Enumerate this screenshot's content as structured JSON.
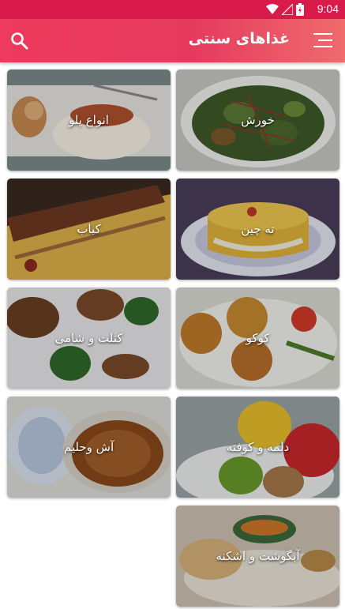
{
  "status_bar": {
    "time": "9:04",
    "icons": [
      "wifi-icon",
      "signal-icon",
      "battery-icon"
    ]
  },
  "app_bar": {
    "title": "غذاهای سنتی",
    "menu_icon": "menu-icon",
    "search_icon": "search-icon",
    "color": "#e8395d"
  },
  "categories": [
    {
      "label": "خورش"
    },
    {
      "label": "انواع پلو"
    },
    {
      "label": "ته چین"
    },
    {
      "label": "کباب"
    },
    {
      "label": "کوکو"
    },
    {
      "label": "کتلت و شامی"
    },
    {
      "label": "دلمه و کوفته"
    },
    {
      "label": "آش وحلیم"
    },
    {
      "label": "آبگوشت و اشکنه"
    }
  ]
}
